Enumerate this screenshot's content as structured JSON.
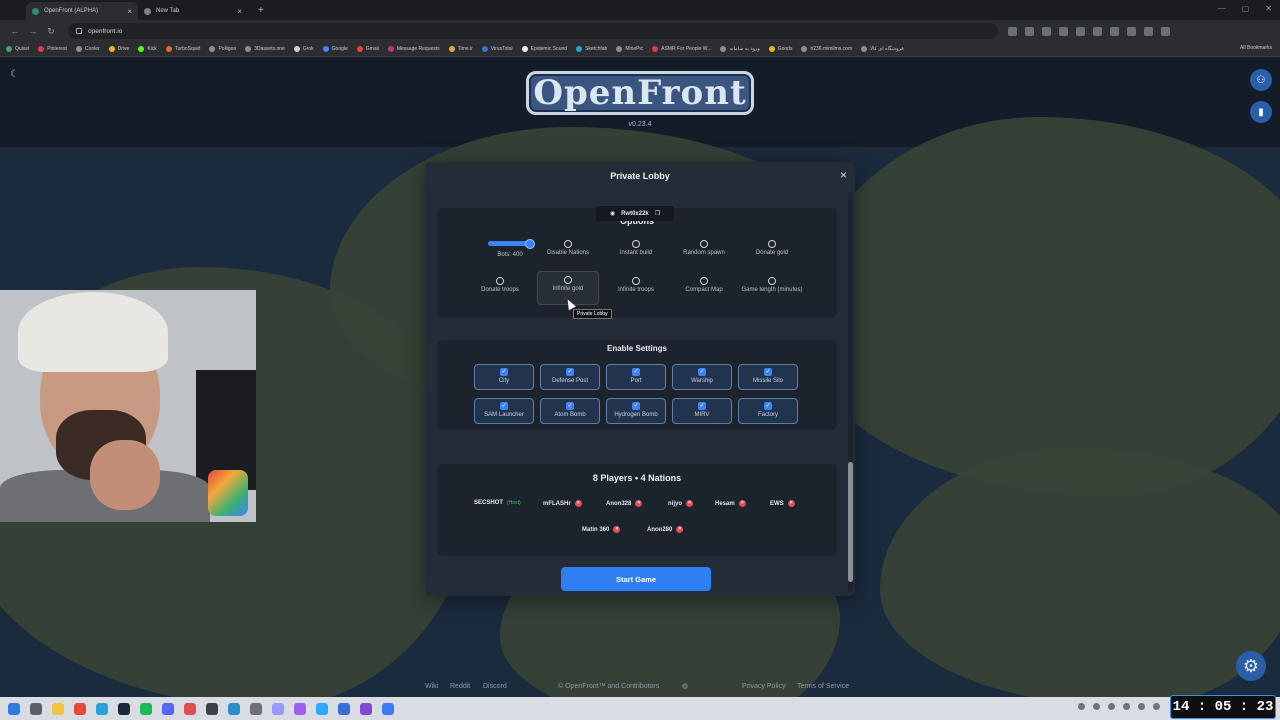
{
  "browser": {
    "tabs": [
      {
        "title": "OpenFront (ALPHA)",
        "active": true
      },
      {
        "title": "New Tab",
        "active": false
      }
    ],
    "url": "openfront.io",
    "bookmarks": [
      "Quixel",
      "Pinterest",
      "Cooler",
      "Drive",
      "Kick",
      "TurboSquid",
      "Poliigon",
      "3Dassets.one",
      "Grok",
      "Google",
      "Gmail",
      "Message Requests",
      "Time.ir",
      "VirusTotal",
      "Epidemic Sound",
      "Sketchfab",
      "MinePic",
      "ASMR For People W...",
      "ورود به سامانه",
      "Goods",
      "h236.mimilms.com",
      "فروشگاه ای کالا"
    ],
    "all_bookmarks": "All Bookmarks"
  },
  "page": {
    "logo_text": "OpenFront",
    "version": "v0.23.4",
    "footer": {
      "wiki": "Wiki",
      "reddit": "Reddit",
      "discord": "Discord",
      "copyright": "© OpenFront™ and Contributors",
      "privacy": "Privacy Policy",
      "terms": "Terms of Service"
    }
  },
  "modal": {
    "title": "Private Lobby",
    "lobby_code": "Rwt0x22k",
    "options_title": "Options",
    "options": [
      {
        "label": "Bots: 400",
        "type": "slider",
        "value": 400
      },
      {
        "label": "Disable Nations",
        "checked": false
      },
      {
        "label": "Instant build",
        "checked": false
      },
      {
        "label": "Random spawn",
        "checked": false
      },
      {
        "label": "Donate gold",
        "checked": false
      },
      {
        "label": "Donate troops",
        "checked": false
      },
      {
        "label": "Infinite gold",
        "checked": false
      },
      {
        "label": "Infinite troops",
        "checked": false
      },
      {
        "label": "Compact Map",
        "checked": false
      },
      {
        "label": "Game length (minutes)",
        "checked": false
      }
    ],
    "tooltip": "Private Lobby",
    "enable_title": "Enable Settings",
    "units": [
      {
        "label": "City",
        "checked": true
      },
      {
        "label": "Defense Post",
        "checked": true
      },
      {
        "label": "Port",
        "checked": true
      },
      {
        "label": "Warship",
        "checked": true
      },
      {
        "label": "Missile Silo",
        "checked": true
      },
      {
        "label": "SAM Launcher",
        "checked": true
      },
      {
        "label": "Atom Bomb",
        "checked": true
      },
      {
        "label": "Hydrogen Bomb",
        "checked": true
      },
      {
        "label": "MIRV",
        "checked": true
      },
      {
        "label": "Factory",
        "checked": true
      }
    ],
    "players_count": "8 Players",
    "nations_count": "4 Nations",
    "separator": "•",
    "players": [
      {
        "name": "SECSHOT",
        "host_label": "(Host)"
      },
      {
        "name": "mFLASHr"
      },
      {
        "name": "Anon328"
      },
      {
        "name": "nijyo"
      },
      {
        "name": "Hesam"
      },
      {
        "name": "EWS"
      },
      {
        "name": "Matin 360"
      },
      {
        "name": "Anon280"
      }
    ],
    "start_button": "Start Game"
  },
  "taskbar": {
    "clock": "14 : 05 : 23"
  },
  "colors": {
    "accent": "#2d7ff2",
    "map_sea": "#233850",
    "map_land": "#4e5d44",
    "kick": "#e14d57",
    "host": "#4cc36c"
  }
}
